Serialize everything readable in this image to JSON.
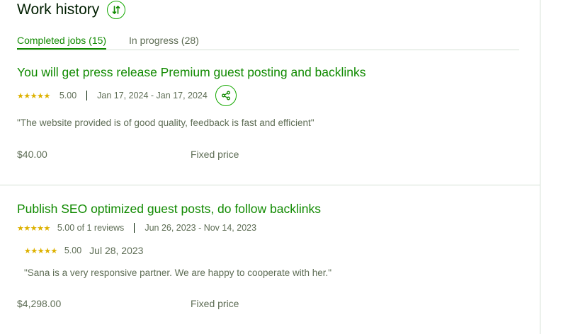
{
  "section_title": "Work history",
  "tabs": [
    {
      "label": "Completed jobs (15)",
      "active": true
    },
    {
      "label": "In progress (28)",
      "active": false
    }
  ],
  "jobs": [
    {
      "title": "You will get press release Premium guest posting and backlinks",
      "stars": "★★★★★",
      "rating": "5.00",
      "dates": "Jan 17, 2024 - Jan 17, 2024",
      "feedback": "\"The website provided is of good quality, feedback is fast and efficient\"",
      "price": "$40.00",
      "price_type": "Fixed price"
    },
    {
      "title": "Publish SEO optimized guest posts, do follow backlinks",
      "stars": "★★★★★",
      "rating": "5.00 of 1 reviews",
      "dates": "Jun 26, 2023 - Nov 14, 2023",
      "review": {
        "stars": "★★★★★",
        "rating": "5.00",
        "date": "Jul 28, 2023"
      },
      "feedback": "\"Sana is a very responsive partner. We are happy to cooperate with her.\"",
      "price": "$4,298.00",
      "price_type": "Fixed price"
    }
  ],
  "colors": {
    "accent": "#108a00",
    "star": "#ddb100",
    "muted": "#5e6d55",
    "border": "#d5e0d5"
  },
  "icons": {
    "sort": "sort-arrows-icon",
    "share": "share-icon",
    "star": "star-icon"
  }
}
